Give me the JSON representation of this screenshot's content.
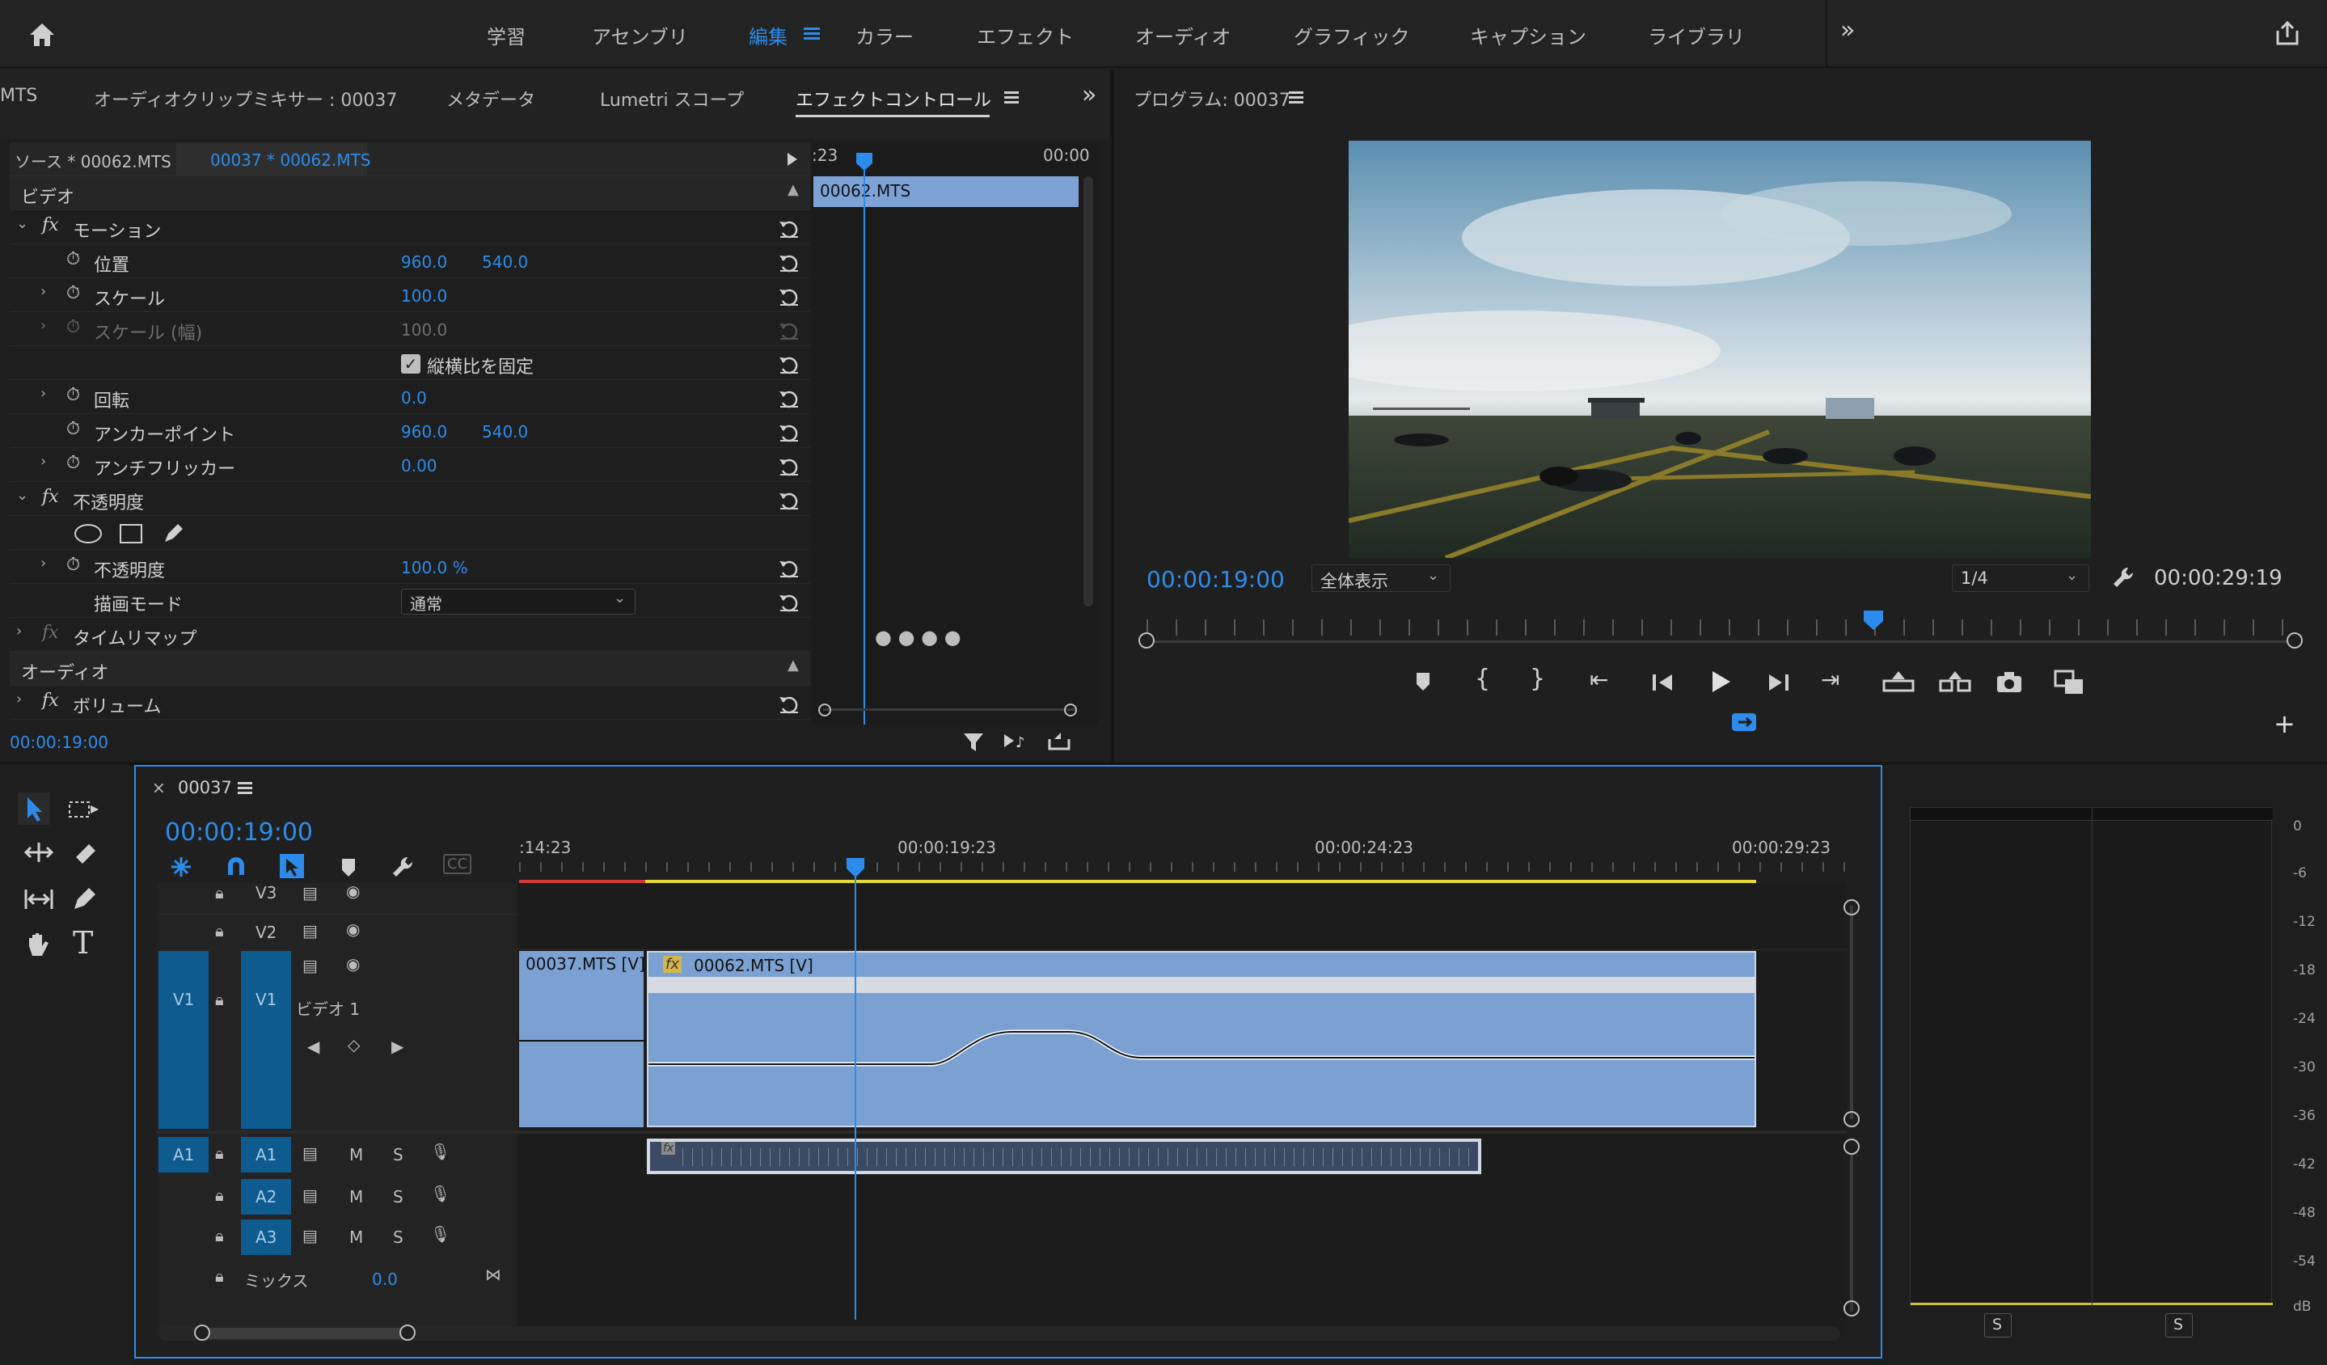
{
  "topbar": {
    "tabs": [
      "学習",
      "アセンブリ",
      "編集",
      "カラー",
      "エフェクト",
      "オーディオ",
      "グラフィック",
      "キャプション",
      "ライブラリ"
    ],
    "active_tab": "編集"
  },
  "effect_panel": {
    "tabs": [
      "MTS",
      "オーディオクリップミキサー : 00037",
      "メタデータ",
      "Lumetri スコープ",
      "エフェクトコントロール"
    ],
    "active_tab": "エフェクトコントロール",
    "source_label": "ソース * 00062.MTS",
    "sequence_label": "00037 * 00062.MTS",
    "video_section": "ビデオ",
    "motion": "モーション",
    "position_label": "位置",
    "position_x": "960.0",
    "position_y": "540.0",
    "scale_label": "スケール",
    "scale_value": "100.0",
    "scale_width_label": "スケール (幅)",
    "scale_width_value": "100.0",
    "uniform_scale_label": "縦横比を固定",
    "rotation_label": "回転",
    "rotation_value": "0.0",
    "anchor_label": "アンカーポイント",
    "anchor_x": "960.0",
    "anchor_y": "540.0",
    "antiflicker_label": "アンチフリッカー",
    "antiflicker_value": "0.00",
    "opacity_group": "不透明度",
    "opacity_label": "不透明度",
    "opacity_value": "100.0 %",
    "blend_label": "描画モード",
    "blend_value": "通常",
    "timeremap_label": "タイムリマップ",
    "audio_section": "オーディオ",
    "volume_label": "ボリューム",
    "timecode": "00:00:19:00",
    "mini_ruler_left": ":23",
    "mini_ruler_right": "00:00",
    "mini_clip": "00062.MTS"
  },
  "program": {
    "title": "プログラム: 00037",
    "timecode": "00:00:19:00",
    "zoom": "全体表示",
    "resolution": "1/4",
    "duration": "00:00:29:19"
  },
  "timeline": {
    "sequence_name": "00037",
    "timecode": "00:00:19:00",
    "ruler_labels": [
      ":14:23",
      "00:00:19:23",
      "00:00:24:23",
      "00:00:29:23"
    ],
    "tracks": {
      "v3": "V3",
      "v2": "V2",
      "v1": "V1",
      "v1_name": "ビデオ 1",
      "a1": "A1",
      "a2": "A2",
      "a3": "A3",
      "mix": "ミックス",
      "mix_value": "0.0",
      "m": "M",
      "s": "S"
    },
    "clip1": "00037.MTS [V]",
    "clip2": "00062.MTS [V]"
  },
  "meter": {
    "db_labels": [
      "0",
      "-6",
      "-12",
      "-18",
      "-24",
      "-30",
      "-36",
      "-42",
      "-48",
      "-54",
      "dB"
    ],
    "solo": "S"
  }
}
